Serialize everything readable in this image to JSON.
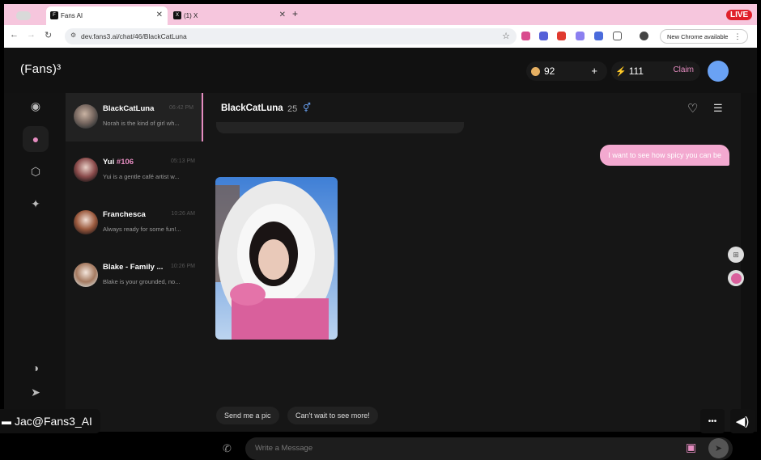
{
  "browser": {
    "tabs": [
      {
        "label": ""
      },
      {
        "label": "Fans AI"
      },
      {
        "label": "(1) X"
      }
    ],
    "new_tab": "+",
    "url": "dev.fans3.ai/chat/46/BlackCatLuna",
    "new_chrome": "New Chrome available",
    "live_badge": "LIVE"
  },
  "app": {
    "logo": "(Fans)³",
    "coins": "92",
    "plus": "+",
    "energy": "111",
    "claim": "Claim"
  },
  "sidebar": {
    "items": [
      "eye-icon",
      "chat-icon",
      "cube-icon",
      "sparkle-icon",
      "discord-icon",
      "telegram-icon"
    ]
  },
  "chat_list": [
    {
      "name": "BlackCatLuna",
      "tag": "",
      "time": "06:42 PM",
      "preview": "Norah is the kind of girl wh..."
    },
    {
      "name": "Yui",
      "tag": "#106",
      "time": "05:13 PM",
      "preview": "Yui is a gentle café artist w..."
    },
    {
      "name": "Franchesca",
      "tag": "",
      "time": "10:26 AM",
      "preview": "Always ready for some fun!..."
    },
    {
      "name": "Blake - Family ...",
      "tag": "",
      "time": "10:26 PM",
      "preview": "Blake is your grounded, no..."
    }
  ],
  "chat": {
    "title": "BlackCatLuna",
    "age": "25",
    "outgoing_message": "I want to see how spicy you can be",
    "suggestions": [
      "Send me a pic",
      "Can't wait to see more!"
    ],
    "composer_placeholder": "Write a Message"
  },
  "overlay": {
    "user": "Jac@Fans3_AI",
    "more": "•••"
  },
  "colors": {
    "accent": "#e58cc0",
    "bubble": "#f3a9d0",
    "live": "#e0202a"
  }
}
